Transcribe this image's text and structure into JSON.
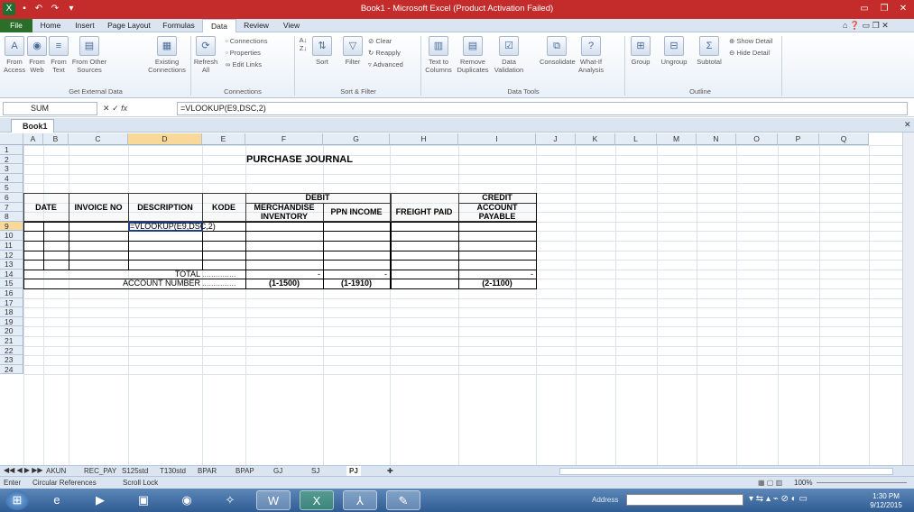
{
  "window": {
    "title": "Book1 - Microsoft Excel (Product Activation Failed)"
  },
  "quick_access": [
    "excel-logo-icon",
    "save-icon",
    "undo-icon",
    "redo-icon",
    "customize-icon"
  ],
  "ribbon_tabs": [
    "File",
    "Home",
    "Insert",
    "Page Layout",
    "Formulas",
    "Data",
    "Review",
    "View"
  ],
  "ribbon_groups": {
    "external": {
      "label": "Get External Data",
      "buttons": [
        "From Access",
        "From Web",
        "From Text",
        "From Other Sources",
        "Existing Connections"
      ]
    },
    "connections": {
      "label": "Connections",
      "refresh": "Refresh All",
      "items": [
        "Connections",
        "Properties",
        "Edit Links"
      ]
    },
    "sortfilter": {
      "label": "Sort & Filter",
      "sort": "Sort",
      "filter": "Filter",
      "items": [
        "Clear",
        "Reapply",
        "Advanced"
      ]
    },
    "datatools": {
      "label": "Data Tools",
      "buttons": [
        "Text to Columns",
        "Remove Duplicates",
        "Data Validation",
        "Consolidate",
        "What-If Analysis"
      ]
    },
    "outline": {
      "label": "Outline",
      "buttons": [
        "Group",
        "Ungroup",
        "Subtotal"
      ],
      "items": [
        "Show Detail",
        "Hide Detail"
      ]
    }
  },
  "formula_bar": {
    "name_box": "SUM",
    "formula": "=VLOOKUP(E9,DSC,2)",
    "fx": "fx"
  },
  "workbook_tab": "Book1",
  "columns": [
    "A",
    "B",
    "C",
    "D",
    "E",
    "F",
    "G",
    "H",
    "I",
    "J",
    "K",
    "L",
    "M",
    "N",
    "O",
    "P",
    "Q"
  ],
  "rows": [
    "1",
    "2",
    "3",
    "4",
    "5",
    "6",
    "7",
    "8",
    "9",
    "10",
    "11",
    "12",
    "13",
    "14",
    "15",
    "16",
    "17",
    "18",
    "19",
    "20",
    "21",
    "22",
    "23",
    "24"
  ],
  "journal": {
    "title": "PURCHASE JOURNAL",
    "date": "DATE",
    "invoice": "INVOICE NO",
    "description": "DESCRIPTION",
    "kode": "KODE",
    "debit": "DEBIT",
    "credit": "CREDIT",
    "merch": "MERCHANDISE INVENTORY",
    "ppn": "PPN INCOME",
    "freight": "FREIGHT PAID",
    "payable": "ACCOUNT PAYABLE",
    "edit_formula": "=VLOOKUP(E9,DSC,2)",
    "total": "TOTAL",
    "dots": "...............",
    "acct_number": "ACCOUNT NUMBER",
    "dash": "-",
    "acct_merch": "(1-1500)",
    "acct_ppn": "(1-1910)",
    "acct_payable": "(2-1100)"
  },
  "sheet_tabs": [
    "AKUN",
    "REC_PAY",
    "S125std",
    "T130std",
    "BPAR",
    "BPAP",
    "GJ",
    "SJ",
    "PJ"
  ],
  "active_sheet": "PJ",
  "status": {
    "mode": "Enter",
    "circular": "Circular References",
    "scroll": "Scroll Lock",
    "zoom": "100%"
  },
  "taskbar": {
    "address_label": "Address",
    "time": "1:30 PM",
    "date": "9/12/2015"
  },
  "colors": {
    "title_bar": "#c42b2b",
    "ribbon": "#dbe5f1",
    "file_tab": "#2a6e2a",
    "selected_header": "#f9d99a"
  }
}
